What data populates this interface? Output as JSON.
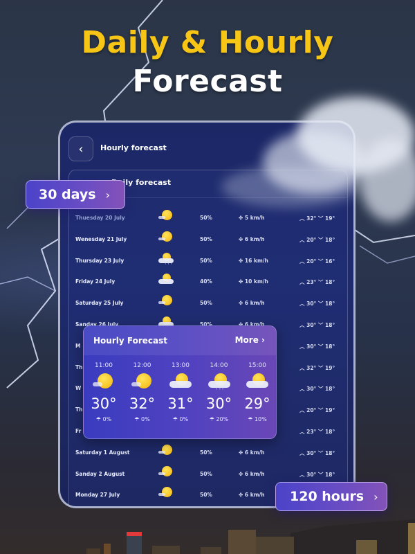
{
  "headline": {
    "line1": "Daily & Hourly",
    "line2": "Forecast"
  },
  "screen": {
    "title": "Hourly forecast",
    "back_icon": "chevron-left-icon",
    "table_header": "Daily forecast"
  },
  "badges": {
    "days": {
      "label": "30 days",
      "icon": "chevron-right-icon"
    },
    "hours": {
      "label": "120 hours",
      "icon": "chevron-right-icon"
    }
  },
  "daily": [
    {
      "day": "Thuesday 20 July",
      "icon": "sunny",
      "precip": "50%",
      "wind": "5 km/h",
      "high": "32°",
      "low": "19°"
    },
    {
      "day": "Wenesday 21 July",
      "icon": "sunny",
      "precip": "50%",
      "wind": "6 km/h",
      "high": "20°",
      "low": "18°"
    },
    {
      "day": "Thursday 23 July",
      "icon": "partly-cloudy-rain",
      "precip": "50%",
      "wind": "16 km/h",
      "high": "20°",
      "low": "16°"
    },
    {
      "day": "Friday 24 July",
      "icon": "partly-cloudy",
      "precip": "40%",
      "wind": "10 km/h",
      "high": "23°",
      "low": "18°"
    },
    {
      "day": "Saturday 25 July",
      "icon": "sunny",
      "precip": "50%",
      "wind": "6 km/h",
      "high": "30°",
      "low": "18°"
    },
    {
      "day": "Sanday 26 July",
      "icon": "partly-cloudy",
      "precip": "50%",
      "wind": "6 km/h",
      "high": "30°",
      "low": "18°"
    },
    {
      "day": "M",
      "icon": "",
      "precip": "",
      "wind": "",
      "high": "30°",
      "low": "18°"
    },
    {
      "day": "Th",
      "icon": "",
      "precip": "",
      "wind": "",
      "high": "32°",
      "low": "19°"
    },
    {
      "day": "W",
      "icon": "",
      "precip": "",
      "wind": "",
      "high": "30°",
      "low": "18°"
    },
    {
      "day": "Th",
      "icon": "",
      "precip": "",
      "wind": "",
      "high": "20°",
      "low": "19°"
    },
    {
      "day": "Fr",
      "icon": "",
      "precip": "",
      "wind": "",
      "high": "23°",
      "low": "18°"
    },
    {
      "day": "Saturday 1 August",
      "icon": "sunny",
      "precip": "50%",
      "wind": "6 km/h",
      "high": "30°",
      "low": "18°"
    },
    {
      "day": "Sanday 2 August",
      "icon": "sunny",
      "precip": "50%",
      "wind": "6 km/h",
      "high": "30°",
      "low": "18°"
    },
    {
      "day": "Monday 27 July",
      "icon": "sunny",
      "precip": "50%",
      "wind": "6 km/h",
      "high": "",
      "low": ""
    }
  ],
  "hourly_card": {
    "title": "Hourly Forecast",
    "more_label": "More",
    "hours": [
      {
        "time": "11:00",
        "icon": "sunny",
        "temp": "30°",
        "rain": "0%"
      },
      {
        "time": "12:00",
        "icon": "sunny",
        "temp": "32°",
        "rain": "0%"
      },
      {
        "time": "13:00",
        "icon": "partly-cloudy",
        "temp": "31°",
        "rain": "0%"
      },
      {
        "time": "14:00",
        "icon": "partly-cloudy-rain",
        "temp": "30°",
        "rain": "20%"
      },
      {
        "time": "15:00",
        "icon": "partly-cloudy",
        "temp": "29°",
        "rain": "10%"
      }
    ]
  },
  "colors": {
    "headline_accent": "#f7c516",
    "badge_start": "#4b43c9",
    "badge_end": "#8452b8",
    "panel_bg": "#1c2766"
  }
}
